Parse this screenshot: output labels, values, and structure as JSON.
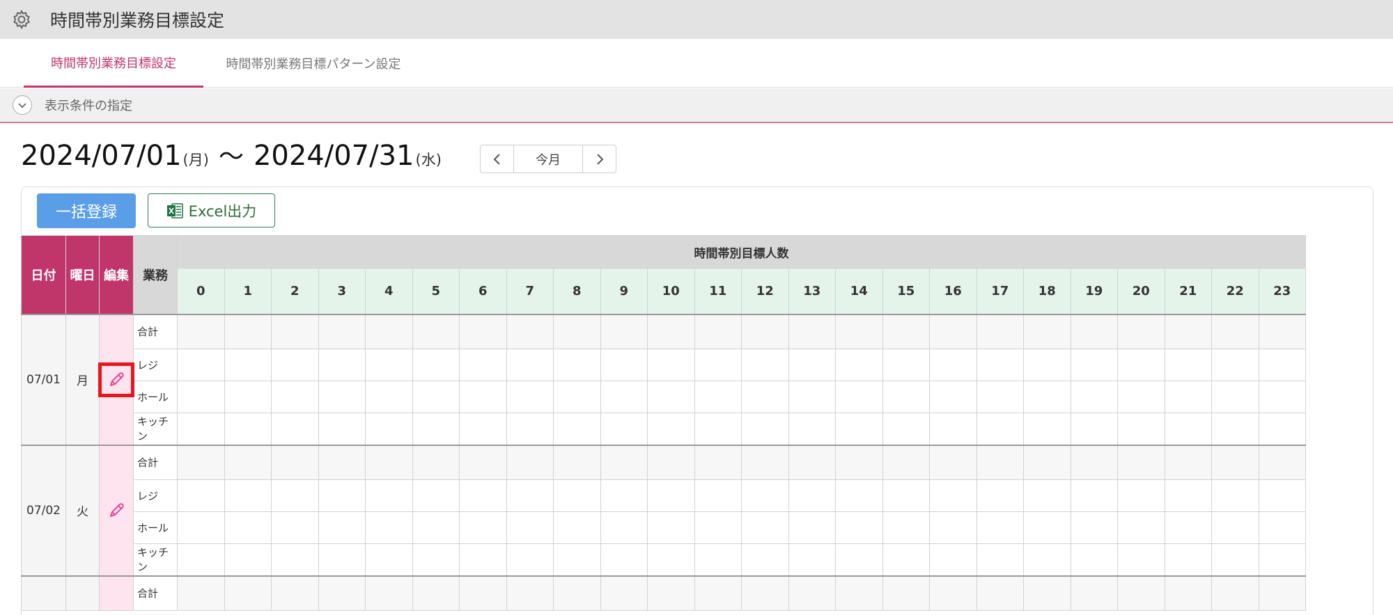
{
  "header": {
    "title": "時間帯別業務目標設定",
    "icon": "gear-icon"
  },
  "tabs": [
    {
      "label": "時間帯別業務目標設定",
      "active": true
    },
    {
      "label": "時間帯別業務目標パターン設定",
      "active": false
    }
  ],
  "conditions": {
    "label": "表示条件の指定",
    "icon": "chevron-down-icon"
  },
  "range": {
    "start_date": "2024/07/01",
    "start_dow": "(月)",
    "separator": "〜",
    "end_date": "2024/07/31",
    "end_dow": "(水)"
  },
  "nav": {
    "prev_icon": "chevron-left-icon",
    "today_label": "今月",
    "next_icon": "chevron-right-icon"
  },
  "toolbar": {
    "bulk_label": "一括登録",
    "excel_label": "Excel出力",
    "excel_icon": "excel-icon"
  },
  "table": {
    "headers": {
      "date": "日付",
      "dow": "曜日",
      "edit": "編集",
      "task": "業務",
      "target": "時間帯別目標人数"
    },
    "hours": [
      "0",
      "1",
      "2",
      "3",
      "4",
      "5",
      "6",
      "7",
      "8",
      "9",
      "10",
      "11",
      "12",
      "13",
      "14",
      "15",
      "16",
      "17",
      "18",
      "19",
      "20",
      "21",
      "22",
      "23"
    ],
    "days": [
      {
        "date": "07/01",
        "dow": "月",
        "tasks": [
          "合計",
          "レジ",
          "ホール",
          "キッチン"
        ],
        "edit_highlighted": true
      },
      {
        "date": "07/02",
        "dow": "火",
        "tasks": [
          "合計",
          "レジ",
          "ホール",
          "キッチン"
        ],
        "edit_highlighted": false
      },
      {
        "date": "",
        "dow": "",
        "tasks": [
          "合計"
        ],
        "edit_highlighted": false
      }
    ]
  },
  "colors": {
    "accent": "#c0366b",
    "edit_bg": "#fde4ef",
    "hour_bg": "#e4f4ea",
    "primary_button": "#5b9ee8",
    "excel_green": "#2f7d4f",
    "highlight": "#e8141e"
  }
}
